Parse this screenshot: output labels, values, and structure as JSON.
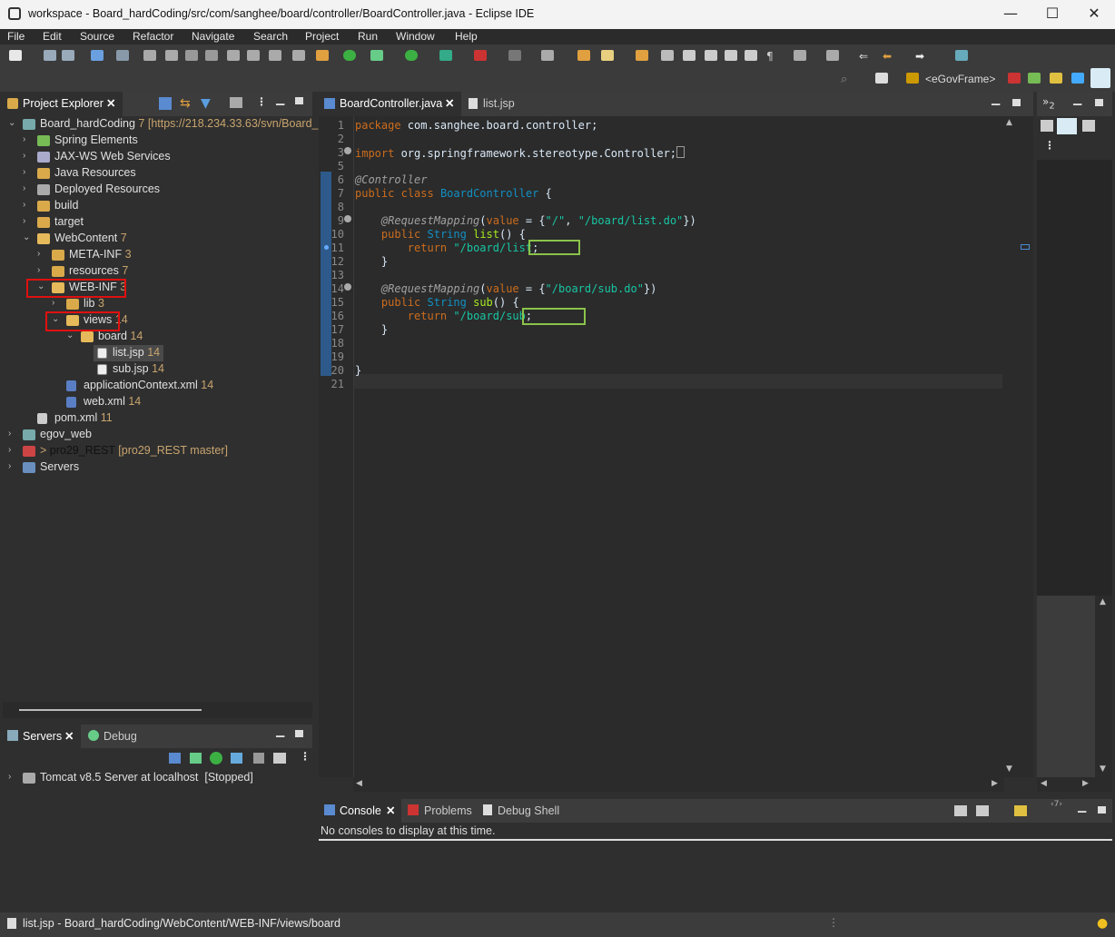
{
  "window": {
    "title": "workspace - Board_hardCoding/src/com/sanghee/board/controller/BoardController.java - Eclipse IDE",
    "minimize": "—",
    "maximize": "☐",
    "close": "✕"
  },
  "menu": [
    "File",
    "Edit",
    "Source",
    "Refactor",
    "Navigate",
    "Search",
    "Project",
    "Run",
    "Window",
    "Help"
  ],
  "toolbar": {
    "perspective_label": "<eGovFrame>"
  },
  "explorer": {
    "tab_label": "Project Explorer",
    "tree": [
      {
        "label": "Board_hardCoding",
        "deco": " 7 [https://218.234.33.63/svn/Board_",
        "expanded": true,
        "icon": "project-icon"
      },
      {
        "label": "Spring Elements",
        "deco": "",
        "icon": "spring-icon"
      },
      {
        "label": "JAX-WS Web Services",
        "deco": "",
        "icon": "webservice-icon"
      },
      {
        "label": "Java Resources",
        "deco": "",
        "icon": "java-resources-icon"
      },
      {
        "label": "Deployed Resources",
        "deco": "",
        "icon": "deployed-icon"
      },
      {
        "label": "build",
        "deco": "",
        "icon": "folder-icon"
      },
      {
        "label": "target",
        "deco": "",
        "icon": "folder-icon"
      },
      {
        "label": "WebContent",
        "deco": " 7",
        "icon": "folder-icon"
      },
      {
        "label": "META-INF",
        "deco": " 3",
        "icon": "folder-icon"
      },
      {
        "label": "resources",
        "deco": " 7",
        "icon": "folder-icon"
      },
      {
        "label": "WEB-INF",
        "deco": " 3",
        "icon": "folder-icon"
      },
      {
        "label": "lib",
        "deco": " 3",
        "icon": "folder-icon"
      },
      {
        "label": "views",
        "deco": " 14",
        "icon": "folder-icon"
      },
      {
        "label": "board",
        "deco": " 14",
        "icon": "folder-icon"
      },
      {
        "label": "list.jsp",
        "deco": " 14",
        "icon": "jsp-file-icon"
      },
      {
        "label": "sub.jsp",
        "deco": " 14",
        "icon": "jsp-file-icon"
      },
      {
        "label": "applicationContext.xml",
        "deco": " 14",
        "icon": "xml-file-icon"
      },
      {
        "label": "web.xml",
        "deco": " 14",
        "icon": "xml-file-icon"
      },
      {
        "label": "pom.xml",
        "deco": " 11",
        "icon": "xml-file-icon"
      },
      {
        "label": "egov_web",
        "deco": "",
        "icon": "project-icon"
      },
      {
        "label": "pro29_REST",
        "deco": " [pro29_REST master]",
        "prefix": "> ",
        "icon": "project-icon"
      },
      {
        "label": "Servers",
        "deco": "",
        "icon": "folder-icon"
      }
    ]
  },
  "servers": {
    "tab_label": "Servers",
    "debug_tab": "Debug",
    "items": [
      {
        "label": "Tomcat v8.5 Server at localhost",
        "status": "[Stopped]"
      }
    ]
  },
  "editor": {
    "tabs": [
      "BoardController.java",
      "list.jsp"
    ],
    "line_numbers": [
      "1",
      "2",
      "3",
      "5",
      "6",
      "7",
      "8",
      "9",
      "10",
      "11",
      "12",
      "13",
      "14",
      "15",
      "16",
      "17",
      "18",
      "19",
      "20",
      "21"
    ]
  },
  "console": {
    "tabs": [
      "Console",
      "Problems",
      "Debug Shell"
    ],
    "message": "No consoles to display at this time."
  },
  "outline": {
    "tab_label": "2"
  },
  "statusbar": {
    "text": "list.jsp - Board_hardCoding/WebContent/WEB-INF/views/board"
  }
}
